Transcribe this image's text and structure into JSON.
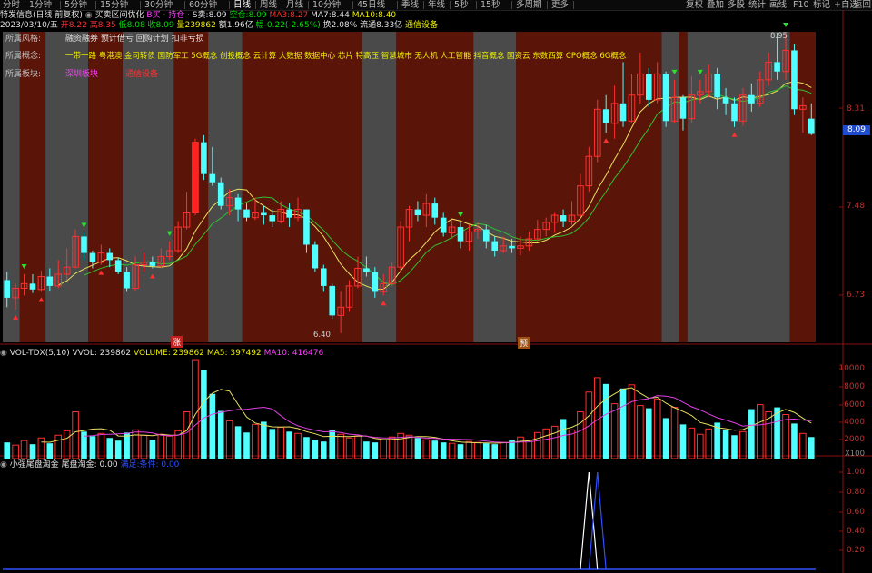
{
  "toolbar": {
    "periods": [
      "分时",
      "1分钟",
      "5分钟",
      "15分钟",
      "30分钟",
      "60分钟",
      "日线",
      "周线",
      "月线",
      "10分钟",
      "45日线",
      "季线",
      "年线",
      "5秒",
      "15秒",
      "多周期",
      "更多"
    ],
    "active_period": "日线",
    "right_buttons": [
      "复权",
      "叠加",
      "多股",
      "统计",
      "画线",
      "F10",
      "标记",
      "+自选",
      "返回"
    ]
  },
  "header": {
    "stock_name": "特发信息(日线 前复权)",
    "indicator_name": "买卖区间优化",
    "legend_b1": "B买",
    "legend_b2": "持仓",
    "legend_s_label": "S卖:",
    "legend_s_value": "8.09",
    "legend_k_label": "空仓:",
    "legend_k_value": "8.09",
    "ma3_label": "MA3:",
    "ma3_value": "8.27",
    "ma7_label": "MA7:",
    "ma7_value": "8.44",
    "ma10_label": "MA10:",
    "ma10_value": "8.40",
    "date": "2023/03/10/五",
    "open_label": "开8.22",
    "high_label": "高8.35",
    "low_label": "低8.08",
    "close_label": "收8.09",
    "volume_label": "量239862",
    "amount_label": "额1.96亿",
    "change_label": "幅-0.22(-2.65%)",
    "turnover_label": "换2.08%",
    "float_label": "流通8.33亿",
    "industry_label": "通信设备"
  },
  "info_box": {
    "style_label": "所属风格:",
    "style_value": "融资融券 预计借亏 回购计划 扣非亏损",
    "concept_label": "所属概念:",
    "concept_value": "一带一路 粤港澳 金司转债 国防军工 5G概念 创投概念 云计算 大数据 数据中心 芯片 特高压 智慧城市 无人机 人工智能 抖音概念 国资云 东数西算 CPO概念 6G概念",
    "board_label": "所属板块:",
    "board_value1": "深圳板块",
    "board_value2": "通信设备"
  },
  "price_axis": {
    "ticks": [
      "8.31",
      "7.48",
      "6.73"
    ],
    "current": "8.09",
    "high_note": "8.95",
    "low_note": "6.40",
    "marker_1": "涨",
    "marker_2": "预"
  },
  "vol_panel": {
    "title": "VOL-TDX(5,10)",
    "vvol_label": "VVOL: 239862",
    "volume_label": "VOLUME: 239862",
    "ma5_label": "MA5: 397492",
    "ma10_label": "MA10: 416476",
    "ticks": [
      "10000",
      "8000",
      "6000",
      "4000",
      "2000"
    ],
    "unit": "X100"
  },
  "ind_panel": {
    "title": "小强尾盘淘金",
    "label1": "尾盘淘金: 0.00",
    "label2": "满足:条件: 0.00",
    "ticks": [
      "1.00",
      "0.80",
      "0.60",
      "0.40",
      "0.20"
    ]
  },
  "colors": {
    "up": "#ff3030",
    "down": "#50ffff",
    "zone_red": "#5a1408",
    "zone_gray": "#4a4a4a",
    "ma_yellow": "#e8e060",
    "ma_green": "#30c030",
    "ma_mag": "#e040e0"
  },
  "candles": [
    [
      6.85,
      6.7,
      6.92,
      6.62
    ],
    [
      6.7,
      6.78,
      6.82,
      6.6
    ],
    [
      6.78,
      6.82,
      6.9,
      6.72
    ],
    [
      6.82,
      6.77,
      6.9,
      6.74
    ],
    [
      6.77,
      6.88,
      6.93,
      6.75
    ],
    [
      6.88,
      6.8,
      6.95,
      6.76
    ],
    [
      6.8,
      6.9,
      7.02,
      6.78
    ],
    [
      6.9,
      6.96,
      7.12,
      6.85
    ],
    [
      6.96,
      7.22,
      7.28,
      6.95
    ],
    [
      7.22,
      7.08,
      7.25,
      7.02
    ],
    [
      7.08,
      7.0,
      7.1,
      6.95
    ],
    [
      7.0,
      7.08,
      7.15,
      6.98
    ],
    [
      7.08,
      7.02,
      7.12,
      6.96
    ],
    [
      7.02,
      6.92,
      7.04,
      6.9
    ],
    [
      6.92,
      6.78,
      6.96,
      6.75
    ],
    [
      6.78,
      6.98,
      7.05,
      6.76
    ],
    [
      6.98,
      7.0,
      7.08,
      6.92
    ],
    [
      7.0,
      6.97,
      7.05,
      6.95
    ],
    [
      6.97,
      7.05,
      7.12,
      6.95
    ],
    [
      7.05,
      7.1,
      7.18,
      7.02
    ],
    [
      7.1,
      7.3,
      7.35,
      7.08
    ],
    [
      7.3,
      7.42,
      7.6,
      7.28
    ],
    [
      7.42,
      8.02,
      8.05,
      7.4
    ],
    [
      8.02,
      7.75,
      8.08,
      7.7
    ],
    [
      7.75,
      7.68,
      7.98,
      7.65
    ],
    [
      7.68,
      7.48,
      7.72,
      7.45
    ],
    [
      7.48,
      7.55,
      7.62,
      7.4
    ],
    [
      7.55,
      7.45,
      7.58,
      7.35
    ],
    [
      7.45,
      7.38,
      7.5,
      7.35
    ],
    [
      7.38,
      7.42,
      7.55,
      7.36
    ],
    [
      7.42,
      7.4,
      7.48,
      7.32
    ],
    [
      7.4,
      7.35,
      7.45,
      7.3
    ],
    [
      7.35,
      7.45,
      7.52,
      7.33
    ],
    [
      7.45,
      7.38,
      7.5,
      7.3
    ],
    [
      7.38,
      7.45,
      7.55,
      7.35
    ],
    [
      7.45,
      7.15,
      7.45,
      7.08
    ],
    [
      7.15,
      6.95,
      7.18,
      6.92
    ],
    [
      6.95,
      6.8,
      6.98,
      6.75
    ],
    [
      6.8,
      6.55,
      6.82,
      6.52
    ],
    [
      6.55,
      6.62,
      6.75,
      6.4
    ],
    [
      6.62,
      6.8,
      6.85,
      6.58
    ],
    [
      6.8,
      6.95,
      7.05,
      6.78
    ],
    [
      6.95,
      6.92,
      7.05,
      6.88
    ],
    [
      6.92,
      6.75,
      6.96,
      6.7
    ],
    [
      6.75,
      6.82,
      6.9,
      6.72
    ],
    [
      6.82,
      6.96,
      7.0,
      6.8
    ],
    [
      6.96,
      7.3,
      7.35,
      6.92
    ],
    [
      7.3,
      7.45,
      7.48,
      7.18
    ],
    [
      7.45,
      7.4,
      7.52,
      7.35
    ],
    [
      7.4,
      7.5,
      7.58,
      7.3
    ],
    [
      7.5,
      7.38,
      7.55,
      7.32
    ],
    [
      7.38,
      7.25,
      7.42,
      7.22
    ],
    [
      7.25,
      7.3,
      7.36,
      7.2
    ],
    [
      7.3,
      7.18,
      7.34,
      7.12
    ],
    [
      7.18,
      7.26,
      7.32,
      7.1
    ],
    [
      7.26,
      7.28,
      7.34,
      7.2
    ],
    [
      7.28,
      7.18,
      7.32,
      7.12
    ],
    [
      7.18,
      7.1,
      7.22,
      7.05
    ],
    [
      7.1,
      7.14,
      7.22,
      7.08
    ],
    [
      7.14,
      7.12,
      7.2,
      7.08
    ],
    [
      7.12,
      7.14,
      7.22,
      7.06
    ],
    [
      7.14,
      7.2,
      7.26,
      7.1
    ],
    [
      7.2,
      7.28,
      7.36,
      7.18
    ],
    [
      7.28,
      7.34,
      7.38,
      7.22
    ],
    [
      7.34,
      7.4,
      7.42,
      7.25
    ],
    [
      7.4,
      7.35,
      7.45,
      7.3
    ],
    [
      7.35,
      7.4,
      7.52,
      7.32
    ],
    [
      7.4,
      7.65,
      7.75,
      7.38
    ],
    [
      7.65,
      7.9,
      7.98,
      7.6
    ],
    [
      7.9,
      8.3,
      8.38,
      7.85
    ],
    [
      8.3,
      8.18,
      8.42,
      8.1
    ],
    [
      8.18,
      8.35,
      8.5,
      8.05
    ],
    [
      8.35,
      8.2,
      8.7,
      8.15
    ],
    [
      8.2,
      8.42,
      8.6,
      8.18
    ],
    [
      8.42,
      8.6,
      8.78,
      8.35
    ],
    [
      8.6,
      8.38,
      8.65,
      8.32
    ],
    [
      8.38,
      8.6,
      8.7,
      8.35
    ],
    [
      8.6,
      8.2,
      8.62,
      8.15
    ],
    [
      8.2,
      8.4,
      8.55,
      8.18
    ],
    [
      8.4,
      8.22,
      8.42,
      8.12
    ],
    [
      8.22,
      8.42,
      8.58,
      8.18
    ],
    [
      8.42,
      8.45,
      8.55,
      8.35
    ],
    [
      8.45,
      8.6,
      8.68,
      8.4
    ],
    [
      8.6,
      8.4,
      8.65,
      8.3
    ],
    [
      8.4,
      8.35,
      8.48,
      8.25
    ],
    [
      8.35,
      8.2,
      8.4,
      8.15
    ],
    [
      8.2,
      8.42,
      8.48,
      8.16
    ],
    [
      8.42,
      8.35,
      8.52,
      8.28
    ],
    [
      8.35,
      8.55,
      8.62,
      8.32
    ],
    [
      8.55,
      8.7,
      8.78,
      8.5
    ],
    [
      8.7,
      8.62,
      8.95,
      8.55
    ],
    [
      8.62,
      8.8,
      8.95,
      8.55
    ],
    [
      8.8,
      8.3,
      8.85,
      8.25
    ],
    [
      8.3,
      8.33,
      8.4,
      8.1
    ],
    [
      8.22,
      8.09,
      8.35,
      8.08
    ]
  ],
  "volumes": [
    1800,
    1500,
    2000,
    1600,
    2300,
    1700,
    2600,
    3100,
    5200,
    3000,
    2500,
    2800,
    2300,
    2000,
    2900,
    3200,
    2600,
    2100,
    2700,
    2500,
    3100,
    5200,
    11000,
    9800,
    7200,
    5300,
    4200,
    3600,
    2900,
    3800,
    4100,
    3300,
    3500,
    3000,
    2800,
    2400,
    2100,
    1900,
    3200,
    2700,
    2300,
    2500,
    1900,
    1800,
    2100,
    2400,
    2800,
    2600,
    2300,
    2100,
    2000,
    1800,
    1700,
    1600,
    1900,
    1800,
    1700,
    1600,
    1800,
    2100,
    2400,
    2000,
    2900,
    3300,
    3600,
    4400,
    3200,
    5200,
    7400,
    9000,
    8300,
    6100,
    7800,
    8200,
    5900,
    5600,
    6600,
    4500,
    5700,
    3800,
    3400,
    2700,
    3300,
    4000,
    3200,
    2600,
    3000,
    5500,
    6000,
    5200,
    5700,
    4900,
    3900,
    2800,
    2399
  ],
  "ind_spikes": [
    {
      "index": 68,
      "value": 1.0,
      "series": "白"
    },
    {
      "index": 69,
      "value": 1.0,
      "series": "蓝"
    }
  ]
}
